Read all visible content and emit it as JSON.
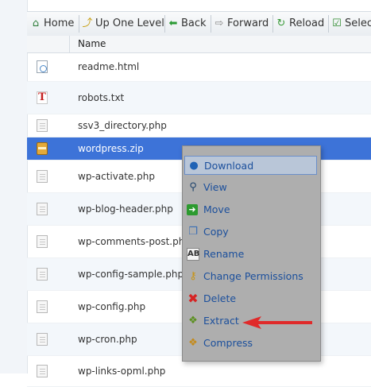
{
  "toolbar": {
    "buttons": [
      {
        "icon": "home-icon",
        "label": "Home"
      },
      {
        "icon": "up-one-level-icon",
        "label": "Up One Level"
      },
      {
        "icon": "back-arrow-icon",
        "label": "Back"
      },
      {
        "icon": "forward-arrow-icon",
        "label": "Forward"
      },
      {
        "icon": "reload-icon",
        "label": "Reload"
      },
      {
        "icon": "select-checkbox-icon",
        "label": "Selec"
      }
    ]
  },
  "table": {
    "column_name": "Name",
    "rows": [
      {
        "name": "readme.html",
        "icon": "html-file-icon"
      },
      {
        "name": "robots.txt",
        "icon": "text-file-icon"
      },
      {
        "name": "ssv3_directory.php",
        "icon": "php-file-icon"
      },
      {
        "name": "wordpress.zip",
        "icon": "zip-archive-icon",
        "selected": true
      },
      {
        "name": "wp-activate.php",
        "icon": "php-file-icon"
      },
      {
        "name": "wp-blog-header.php",
        "icon": "php-file-icon"
      },
      {
        "name": "wp-comments-post.php",
        "icon": "php-file-icon"
      },
      {
        "name": "wp-config-sample.php",
        "icon": "php-file-icon"
      },
      {
        "name": "wp-config.php",
        "icon": "php-file-icon"
      },
      {
        "name": "wp-cron.php",
        "icon": "php-file-icon"
      },
      {
        "name": "wp-links-opml.php",
        "icon": "php-file-icon"
      }
    ]
  },
  "context_menu": {
    "items": [
      {
        "label": "Download",
        "icon": "globe-download-icon"
      },
      {
        "label": "View",
        "icon": "magnifier-icon"
      },
      {
        "label": "Move",
        "icon": "move-arrow-icon"
      },
      {
        "label": "Copy",
        "icon": "copy-icon"
      },
      {
        "label": "Rename",
        "icon": "rename-ab-icon"
      },
      {
        "label": "Change Permissions",
        "icon": "key-icon"
      },
      {
        "label": "Delete",
        "icon": "red-x-icon"
      },
      {
        "label": "Extract",
        "icon": "extract-icon"
      },
      {
        "label": "Compress",
        "icon": "compress-icon"
      }
    ],
    "highlighted_item": "Download"
  },
  "colors": {
    "selected_row": "#3d73d8",
    "menu_background": "#aeaeae",
    "menu_text": "#1b4f9c",
    "annotation_arrow": "#e02a2a"
  }
}
